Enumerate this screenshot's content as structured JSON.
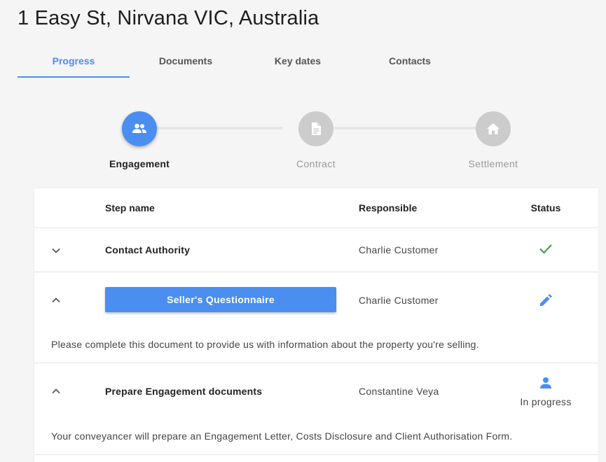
{
  "page": {
    "title": "1 Easy St, Nirvana VIC, Australia"
  },
  "tabs": [
    {
      "label": "Progress",
      "active": true
    },
    {
      "label": "Documents",
      "active": false
    },
    {
      "label": "Key dates",
      "active": false
    },
    {
      "label": "Contacts",
      "active": false
    }
  ],
  "stages": [
    {
      "label": "Engagement",
      "icon": "people-icon",
      "active": true
    },
    {
      "label": "Contract",
      "icon": "document-icon",
      "active": false
    },
    {
      "label": "Settlement",
      "icon": "home-icon",
      "active": false
    }
  ],
  "table": {
    "headers": {
      "step_name": "Step name",
      "responsible": "Responsible",
      "status": "Status"
    },
    "rows": [
      {
        "expand_icon": "chevron-down-icon",
        "step_name": "Contact Authority",
        "responsible": "Charlie Customer",
        "status_icon": "checkmark-icon",
        "status_text": "",
        "description": ""
      },
      {
        "expand_icon": "chevron-up-icon",
        "step_name": "Seller's Questionnaire",
        "responsible": "Charlie Customer",
        "status_icon": "pencil-icon",
        "status_text": "",
        "description": "Please complete this document to provide us with information about the property you're selling."
      },
      {
        "expand_icon": "chevron-up-icon",
        "step_name": "Prepare Engagement documents",
        "responsible": "Constantine Veya",
        "status_icon": "person-icon",
        "status_text": "In progress",
        "description": "Your conveyancer will prepare an Engagement Letter, Costs Disclosure and Client Authorisation Form."
      }
    ]
  },
  "colors": {
    "accent": "#4a8ef0",
    "success": "#43a047",
    "inactive_stage": "#cccccc",
    "background": "#f5f5f5"
  }
}
